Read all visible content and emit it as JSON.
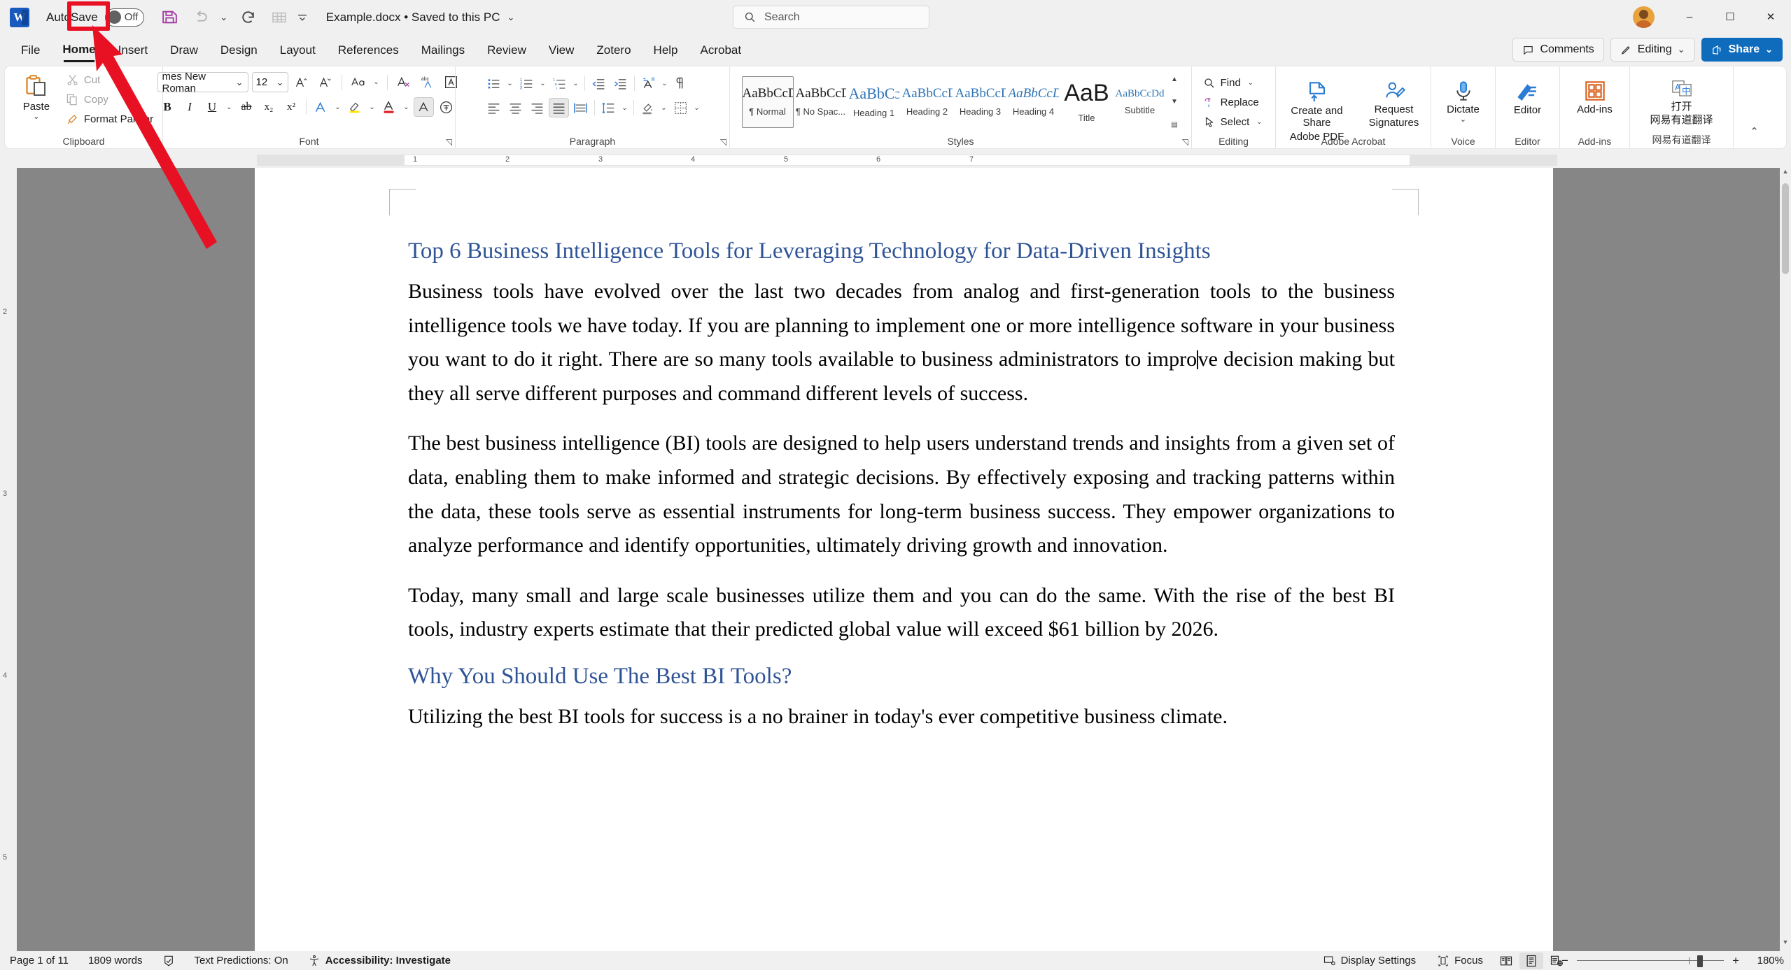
{
  "app": {
    "name": "Microsoft Word",
    "logo_letter": "W"
  },
  "titlebar": {
    "autosave_label": "AutoSave",
    "autosave_state": "Off",
    "save_icon": "save-icon",
    "undo_icon": "undo-icon",
    "redo_icon": "redo-icon",
    "table_icon": "table-icon",
    "customize_icon": "customize-quick-access-icon",
    "doc_title": "Example.docx • Saved to this PC",
    "minimize": "–",
    "maximize": "☐",
    "close": "✕"
  },
  "search": {
    "placeholder": "Search",
    "icon": "search-icon"
  },
  "tabs": [
    {
      "label": "File",
      "active": false
    },
    {
      "label": "Home",
      "active": true
    },
    {
      "label": "Insert",
      "active": false
    },
    {
      "label": "Draw",
      "active": false
    },
    {
      "label": "Design",
      "active": false
    },
    {
      "label": "Layout",
      "active": false
    },
    {
      "label": "References",
      "active": false
    },
    {
      "label": "Mailings",
      "active": false
    },
    {
      "label": "Review",
      "active": false
    },
    {
      "label": "View",
      "active": false
    },
    {
      "label": "Zotero",
      "active": false
    },
    {
      "label": "Help",
      "active": false
    },
    {
      "label": "Acrobat",
      "active": false
    }
  ],
  "tab_actions": {
    "comments": "Comments",
    "editing": "Editing",
    "share": "Share"
  },
  "ribbon": {
    "clipboard": {
      "group_label": "Clipboard",
      "paste": "Paste",
      "cut": "Cut",
      "copy": "Copy",
      "format_painter": "Format Painter"
    },
    "font": {
      "group_label": "Font",
      "font_name": "mes New Roman",
      "font_size": "12",
      "grow": "grow-font-icon",
      "shrink": "shrink-font-icon",
      "change_case": "change-case-icon",
      "clear_formatting": "clear-formatting-icon",
      "phonetic_guide": "phonetic-guide-icon",
      "char_border": "character-border-icon",
      "bold": "B",
      "italic": "I",
      "underline": "U",
      "strikethrough": "strikethrough-icon",
      "subscript": "subscript-icon",
      "superscript": "superscript-icon",
      "text_effects": "text-effects-icon",
      "highlight": "text-highlight-icon",
      "font_color": "font-color-icon",
      "char_shading": "character-shading-icon",
      "enclose_char": "enclose-characters-icon"
    },
    "paragraph": {
      "group_label": "Paragraph",
      "bullets": "bullets-icon",
      "numbering": "numbering-icon",
      "multilevel": "multilevel-list-icon",
      "decrease_indent": "decrease-indent-icon",
      "increase_indent": "increase-indent-icon",
      "sort": "sort-icon",
      "show_marks": "show-formatting-marks-icon",
      "align_left": "align-left-icon",
      "align_center": "align-center-icon",
      "align_right": "align-right-icon",
      "justify": "justify-icon",
      "distributed": "distributed-icon",
      "line_spacing": "line-spacing-icon",
      "shading": "shading-icon",
      "borders": "borders-icon"
    },
    "styles": {
      "group_label": "Styles",
      "items": [
        {
          "preview": "AaBbCcD",
          "name": "¶ Normal",
          "selected": true
        },
        {
          "preview": "AaBbCcD",
          "name": "¶ No Spac...",
          "selected": false
        },
        {
          "preview": "AaBbCɔ",
          "name": "Heading 1",
          "selected": false
        },
        {
          "preview": "AaBbCcD",
          "name": "Heading 2",
          "selected": false
        },
        {
          "preview": "AaBbCcDɔ",
          "name": "Heading 3",
          "selected": false
        },
        {
          "preview": "AaBbCcDɔ",
          "name": "Heading 4",
          "selected": false
        },
        {
          "preview": "AaB",
          "name": "Title",
          "selected": false
        },
        {
          "preview": "AaBbCcDd",
          "name": "Subtitle",
          "selected": false
        }
      ]
    },
    "editing": {
      "group_label": "Editing",
      "find": "Find",
      "replace": "Replace",
      "select": "Select"
    },
    "acrobat": {
      "group_label": "Adobe Acrobat",
      "create_share": "Create and Share\nAdobe PDF",
      "create_share_l1": "Create and Share",
      "create_share_l2": "Adobe PDF",
      "request_l1": "Request",
      "request_l2": "Signatures"
    },
    "voice": {
      "group_label": "Voice",
      "dictate": "Dictate"
    },
    "editor_grp": {
      "group_label": "Editor",
      "editor": "Editor"
    },
    "addins": {
      "group_label": "Add-ins",
      "addins": "Add-ins"
    },
    "youdao": {
      "group_label": "网易有道翻译",
      "line1": "打开",
      "line2": "网易有道翻译"
    },
    "collapse": "collapse-ribbon-icon"
  },
  "ruler": {
    "marks": [
      "1",
      "2",
      "3",
      "4",
      "5",
      "6",
      "7"
    ]
  },
  "document": {
    "heading1": "Top 6 Business Intelligence Tools for Leveraging Technology for Data-Driven Insights",
    "para1_a": "Business tools have evolved over the last two decades from analog and first-generation tools to the business intelligence tools we have today.  If you are planning to implement one or more intelligence software in your business you want to do it right. There are so many tools available to business administrators to impro",
    "para1_b": "ve decision making but they all serve different purposes and command different levels of success.",
    "para2": "The best business intelligence (BI) tools are designed to help users understand trends and insights from a given set of data, enabling them to make informed and strategic decisions. By effectively exposing and tracking patterns within the data, these tools serve as essential instruments for long-term business success. They empower organizations to analyze performance and identify opportunities, ultimately driving growth and innovation.",
    "para3": "Today, many small and large scale businesses utilize them and you can do the same. With the rise of the best BI tools, industry experts estimate that their predicted global value will exceed $61 billion by 2026.",
    "heading2": "Why You Should Use The Best BI Tools?",
    "para4": "Utilizing the best BI tools for success is a no brainer in today's ever competitive business climate."
  },
  "statusbar": {
    "page": "Page 1 of 11",
    "words": "1809 words",
    "proofing_icon": "proofing-errors-icon",
    "text_predictions": "Text Predictions: On",
    "accessibility": "Accessibility: Investigate",
    "display_settings": "Display Settings",
    "focus": "Focus",
    "read_mode_icon": "read-mode-icon",
    "print_layout_icon": "print-layout-icon",
    "web_layout_icon": "web-layout-icon",
    "zoom_out": "−",
    "zoom_in": "+",
    "zoom_level": "180%"
  },
  "annotations": {
    "highlight_box": "red-highlight-box-on-save-button",
    "arrow": "red-pointer-arrow",
    "colors": {
      "annotation_red": "#e81123",
      "accent_blue": "#0f6cbd",
      "heading_blue": "#2f5496"
    }
  }
}
